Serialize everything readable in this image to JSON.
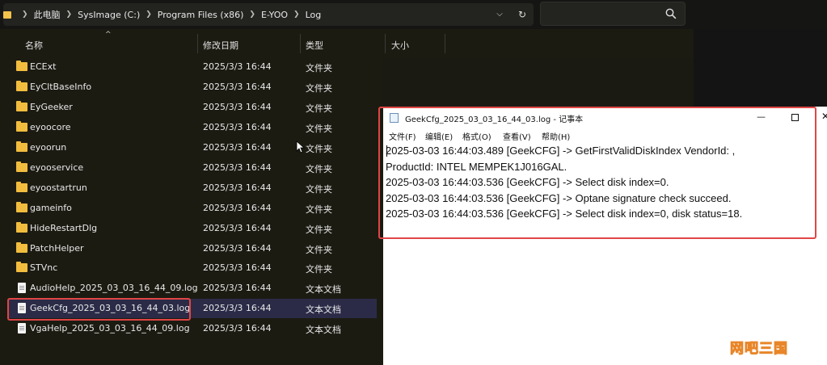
{
  "address_bar": {
    "breadcrumbs": [
      "此电脑",
      "SysImage (C:)",
      "Program Files (x86)",
      "E-YOO",
      "Log"
    ],
    "search_placeholder": ""
  },
  "columns": {
    "name": "名称",
    "date": "修改日期",
    "type": "类型",
    "size": "大小"
  },
  "files": [
    {
      "name": "ECExt",
      "date": "2025/3/3 16:44",
      "type": "文件夹",
      "icon": "folder-icon"
    },
    {
      "name": "EyCltBaseInfo",
      "date": "2025/3/3 16:44",
      "type": "文件夹",
      "icon": "folder-icon"
    },
    {
      "name": "EyGeeker",
      "date": "2025/3/3 16:44",
      "type": "文件夹",
      "icon": "folder-icon"
    },
    {
      "name": "eyoocore",
      "date": "2025/3/3 16:44",
      "type": "文件夹",
      "icon": "folder-icon"
    },
    {
      "name": "eyoorun",
      "date": "2025/3/3 16:44",
      "type": "文件夹",
      "icon": "folder-icon"
    },
    {
      "name": "eyooservice",
      "date": "2025/3/3 16:44",
      "type": "文件夹",
      "icon": "folder-icon"
    },
    {
      "name": "eyoostartrun",
      "date": "2025/3/3 16:44",
      "type": "文件夹",
      "icon": "folder-icon"
    },
    {
      "name": "gameinfo",
      "date": "2025/3/3 16:44",
      "type": "文件夹",
      "icon": "folder-icon"
    },
    {
      "name": "HideRestartDlg",
      "date": "2025/3/3 16:44",
      "type": "文件夹",
      "icon": "folder-icon"
    },
    {
      "name": "PatchHelper",
      "date": "2025/3/3 16:44",
      "type": "文件夹",
      "icon": "folder-icon"
    },
    {
      "name": "STVnc",
      "date": "2025/3/3 16:44",
      "type": "文件夹",
      "icon": "folder-icon"
    },
    {
      "name": "AudioHelp_2025_03_03_16_44_09.log",
      "date": "2025/3/3 16:44",
      "type": "文本文档",
      "icon": "text-file-icon"
    },
    {
      "name": "GeekCfg_2025_03_03_16_44_03.log",
      "date": "2025/3/3 16:44",
      "type": "文本文档",
      "icon": "text-file-icon",
      "selected": true
    },
    {
      "name": "VgaHelp_2025_03_03_16_44_09.log",
      "date": "2025/3/3 16:44",
      "type": "文本文档",
      "icon": "text-file-icon"
    }
  ],
  "notepad": {
    "title": "GeekCfg_2025_03_03_16_44_03.log - 记事本",
    "menu": [
      "文件(F)",
      "编辑(E)",
      "格式(O)",
      "查看(V)",
      "帮助(H)"
    ],
    "lines": [
      "2025-03-03 16:44:03.489 [GeekCFG] -> GetFirstValidDiskIndex VendorId: ,",
      "ProductId: INTEL MEMPEK1J016GAL.",
      "2025-03-03 16:44:03.536 [GeekCFG] -> Select disk index=0.",
      "2025-03-03 16:44:03.536 [GeekCFG] -> Optane signature check succeed.",
      "2025-03-03 16:44:03.536 [GeekCFG] -> Select disk index=0, disk status=18."
    ]
  },
  "watermark": "网吧三国",
  "colors": {
    "highlight_box": "#e04646",
    "selected_row": "#2b2b48",
    "folder": "#f2bd3e"
  }
}
